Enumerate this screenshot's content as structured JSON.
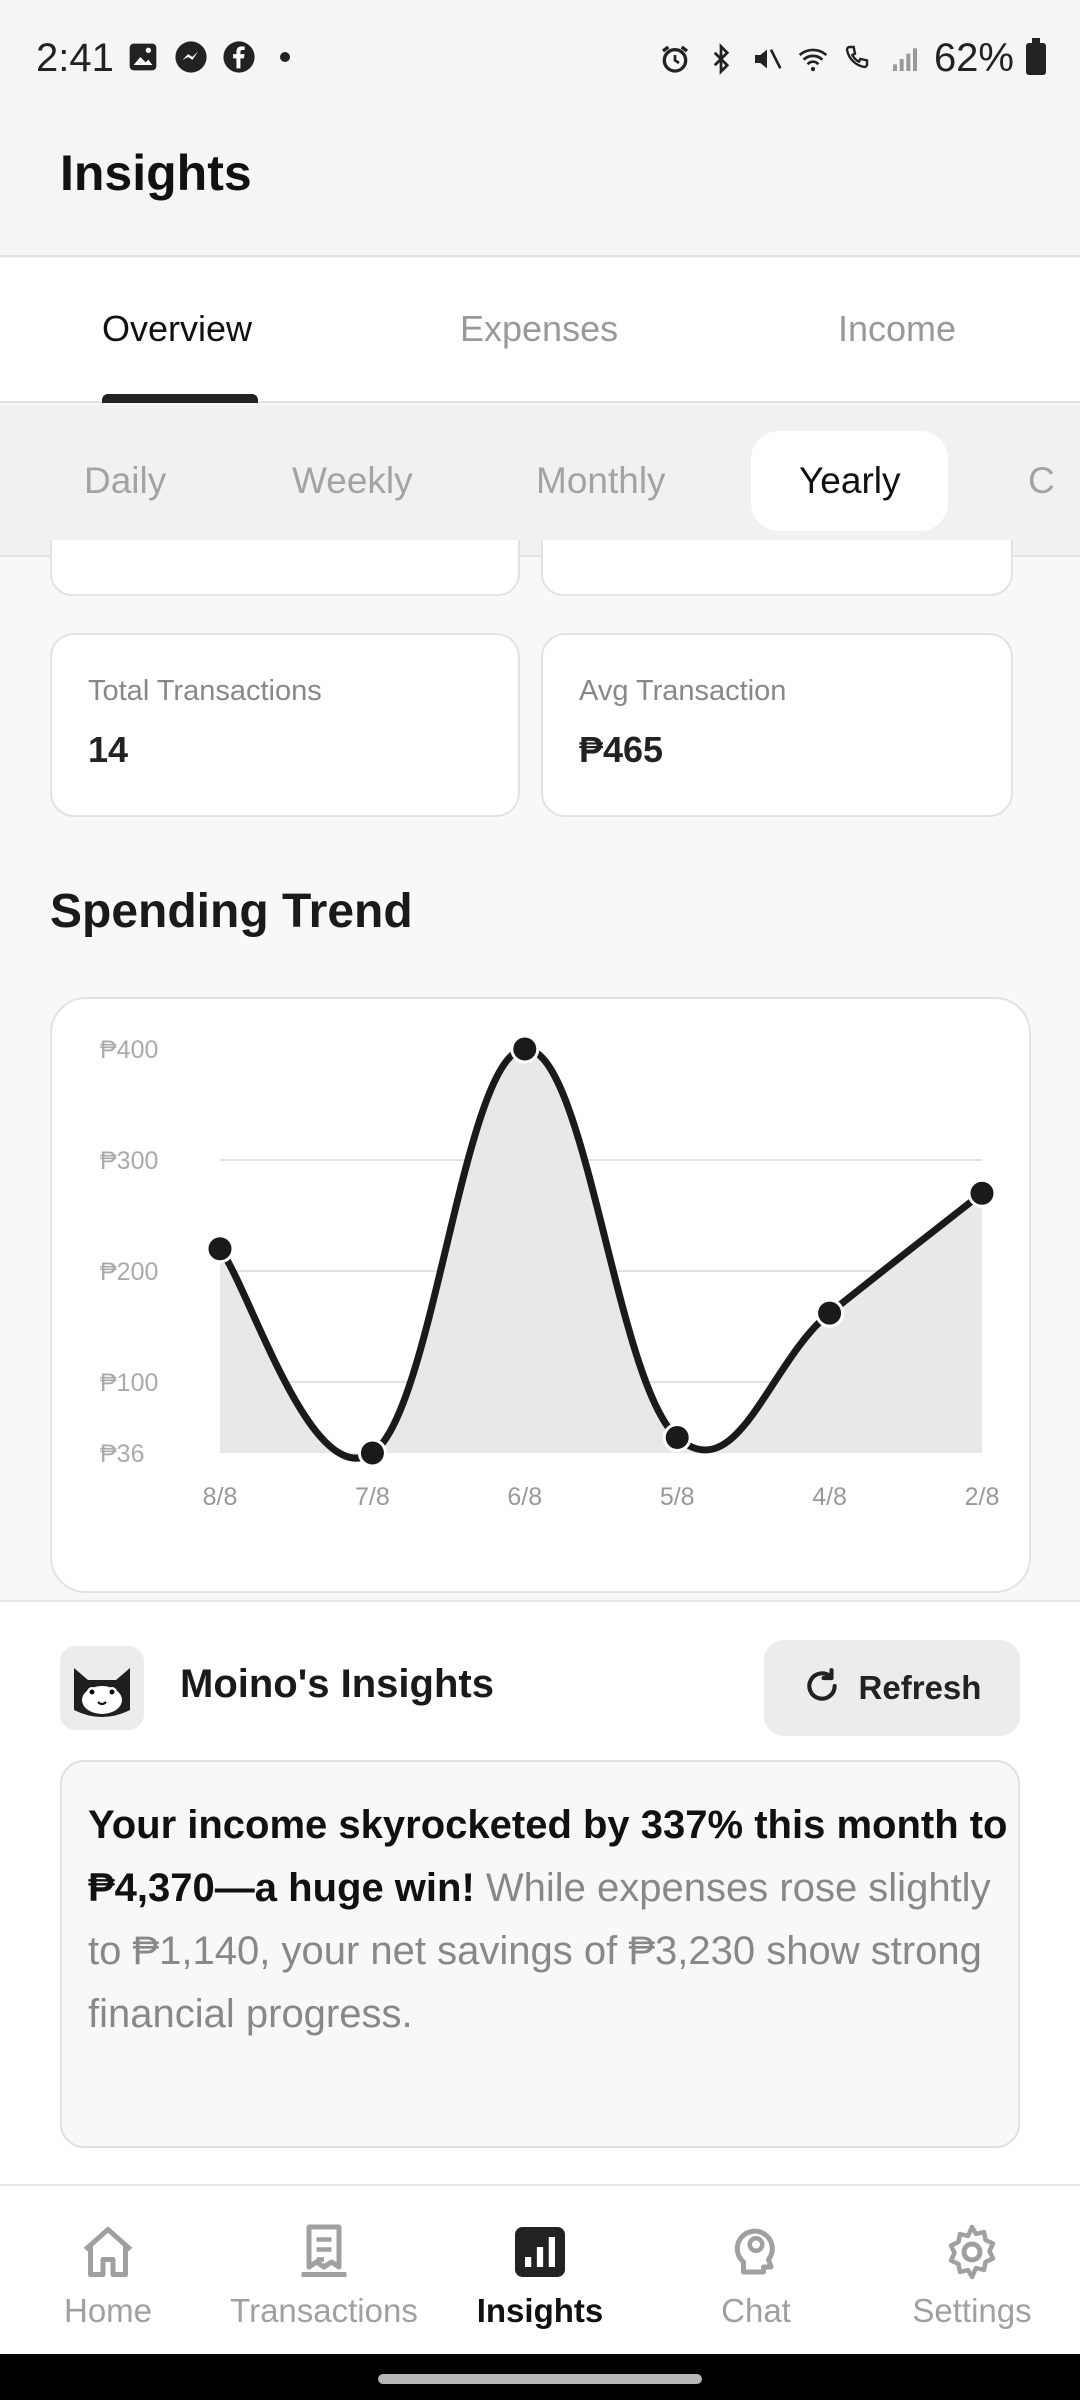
{
  "status_bar": {
    "time": "2:41",
    "battery": "62%"
  },
  "header": {
    "title": "Insights"
  },
  "tabs": [
    {
      "label": "Overview",
      "active": true
    },
    {
      "label": "Expenses",
      "active": false
    },
    {
      "label": "Income",
      "active": false
    }
  ],
  "periods": [
    {
      "label": "Daily",
      "active": false
    },
    {
      "label": "Weekly",
      "active": false
    },
    {
      "label": "Monthly",
      "active": false
    },
    {
      "label": "Yearly",
      "active": true
    },
    {
      "label": "C",
      "active": false
    }
  ],
  "stats": {
    "total_transactions": {
      "label": "Total Transactions",
      "value": "14"
    },
    "avg_transaction": {
      "label": "Avg Transaction",
      "value": "₱465"
    }
  },
  "spending_trend": {
    "title": "Spending Trend"
  },
  "chart_data": {
    "type": "line",
    "categories": [
      "8/8",
      "7/8",
      "6/8",
      "5/8",
      "4/8",
      "2/8"
    ],
    "values": [
      220,
      36,
      400,
      50,
      162,
      270
    ],
    "y_ticks": [
      {
        "value": 400,
        "label": "₱400"
      },
      {
        "value": 300,
        "label": "₱300"
      },
      {
        "value": 200,
        "label": "₱200"
      },
      {
        "value": 100,
        "label": "₱100"
      },
      {
        "value": 36,
        "label": "₱36"
      }
    ],
    "ylim": [
      36,
      400
    ],
    "grid": true,
    "area_fill": true,
    "line_color": "#1a1a1a",
    "fill_color": "#e8e8e8"
  },
  "insights": {
    "title": "Moino's Insights",
    "refresh_label": "Refresh",
    "text_bold": "Your income skyrocketed by 337% this month to ₱4,370—a huge win!",
    "text_rest": " While expenses rose slightly to ₱1,140, your net savings of ₱3,230 show strong financial progress."
  },
  "bottom_nav": [
    {
      "label": "Home",
      "icon": "home-icon",
      "active": false
    },
    {
      "label": "Transactions",
      "icon": "receipt-icon",
      "active": false
    },
    {
      "label": "Insights",
      "icon": "chart-icon",
      "active": true
    },
    {
      "label": "Chat",
      "icon": "brain-icon",
      "active": false
    },
    {
      "label": "Settings",
      "icon": "gear-icon",
      "active": false
    }
  ],
  "colors": {
    "accent": "#1a1a1a",
    "muted": "#a0a0a0",
    "background": "#f8f8f8"
  }
}
